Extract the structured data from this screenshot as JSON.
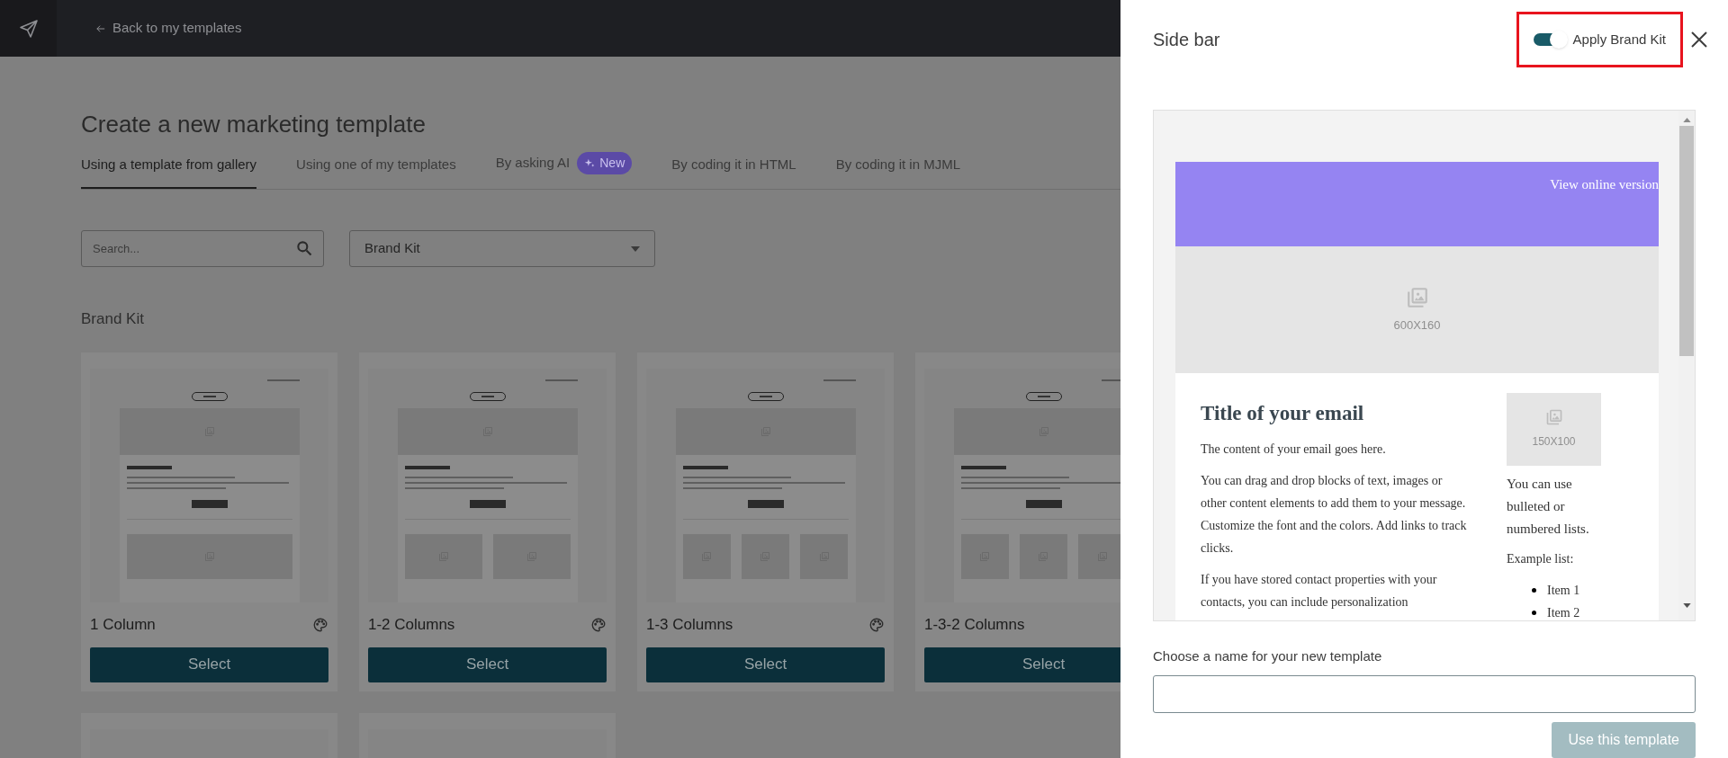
{
  "header": {
    "back_link": "Back to my templates"
  },
  "page": {
    "title": "Create a new marketing template",
    "tabs": [
      {
        "label": "Using a template from gallery",
        "selected": true
      },
      {
        "label": "Using one of my templates",
        "selected": false
      },
      {
        "label": "By asking AI",
        "selected": false,
        "badge": "New"
      },
      {
        "label": "By coding it in HTML",
        "selected": false
      },
      {
        "label": "By coding it in MJML",
        "selected": false
      }
    ],
    "search": {
      "placeholder": "Search..."
    },
    "filter": {
      "value": "Brand Kit"
    },
    "section_title": "Brand Kit",
    "templates": [
      {
        "kind": "one",
        "name": "1 Column",
        "brand_kit": true,
        "button": "Select"
      },
      {
        "kind": "two",
        "name": "1-2 Columns",
        "brand_kit": true,
        "button": "Select"
      },
      {
        "kind": "three",
        "name": "1-3 Columns",
        "brand_kit": true,
        "button": "Select"
      },
      {
        "kind": "three",
        "name": "1-3-2 Columns",
        "button": "Select"
      }
    ],
    "more_templates": [
      {
        "kind": "partial"
      },
      {
        "kind": "partial"
      }
    ]
  },
  "sidebar": {
    "title": "Side bar",
    "brand_kit_toggle": {
      "label": "Apply Brand Kit",
      "on": true,
      "highlighted": true
    },
    "preview": {
      "view_online": "View online version",
      "hero_image": "600X160",
      "title": "Title of your email",
      "paragraphs": [
        "The content of your email goes here.",
        "You can drag and drop blocks of text, images or other content elements to add them to your message. Customize the font and the colors. Add links to track clicks.",
        "If you have stored contact properties with your contacts, you can include personalization"
      ],
      "side_image": "150X100",
      "side_text": "You can use bulleted or numbered lists.",
      "list_label": "Example list:",
      "list_items": [
        "Item 1",
        "Item 2"
      ]
    },
    "name_field": {
      "label": "Choose a name for your new template"
    },
    "submit": {
      "label": "Use this template",
      "disabled": true
    }
  }
}
